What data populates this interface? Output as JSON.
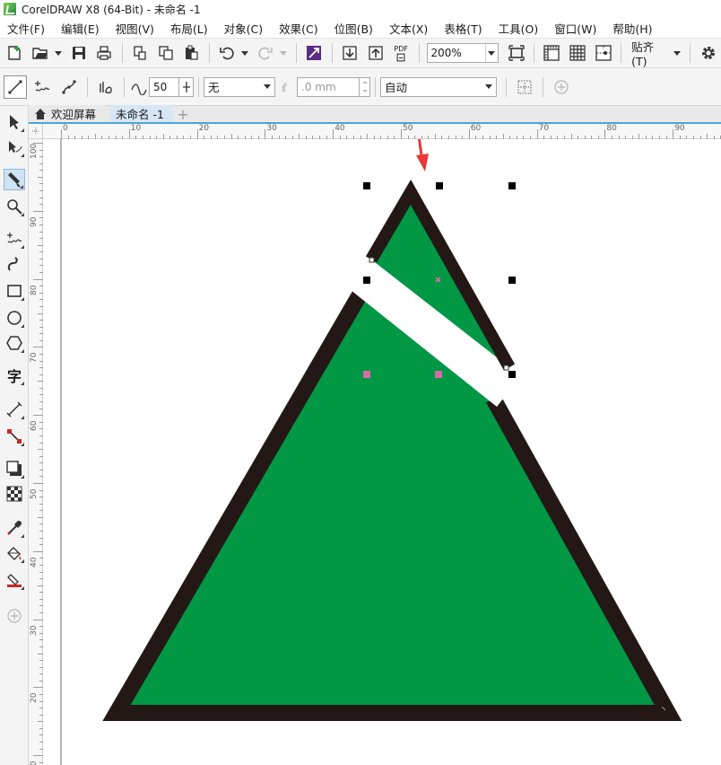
{
  "window": {
    "title": "CorelDRAW X8 (64-Bit) - 未命名 -1"
  },
  "menu": [
    "文件(F)",
    "编辑(E)",
    "视图(V)",
    "布局(L)",
    "对象(C)",
    "效果(C)",
    "位图(B)",
    "文本(X)",
    "表格(T)",
    "工具(O)",
    "窗口(W)",
    "帮助(H)"
  ],
  "toolbar": {
    "zoom_value": "200%",
    "pdf_label": "PDF",
    "snap_label": "贴齐(T)"
  },
  "propbar": {
    "smoothing_value": "50",
    "fill_select": "无",
    "outline_width": ".0 mm",
    "mode_select": "自动"
  },
  "tabs": {
    "welcome": "欢迎屏幕",
    "document": "未命名 -1"
  },
  "toolbox": {
    "text_tool_glyph": "字"
  },
  "ruler": {
    "h_labels": [
      "0",
      "10",
      "20",
      "30",
      "40",
      "50",
      "60",
      "70",
      "80",
      "90"
    ],
    "v_labels": [
      "100",
      "90",
      "80",
      "70",
      "60",
      "50",
      "40",
      "30",
      "20",
      "10"
    ]
  },
  "colors": {
    "shape_fill": "#009845",
    "shape_outline": "#231815",
    "selection_handle": "#000000",
    "arrow_annotation": "#e53935",
    "tab_accent": "#4aa3df"
  },
  "icons": {
    "annotation": "red-arrow-icon"
  }
}
